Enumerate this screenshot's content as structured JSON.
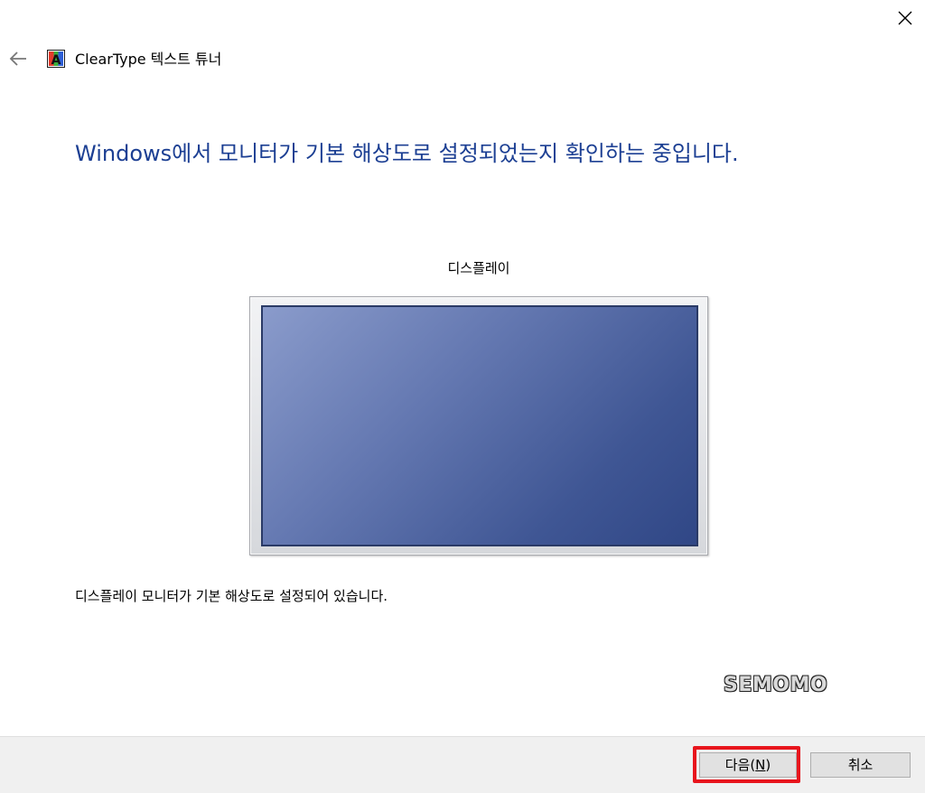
{
  "window": {
    "title": "ClearType 텍스트 튜너",
    "close_icon": "close-icon",
    "back_icon": "arrow-left-icon",
    "app_icon": "cleartype-icon"
  },
  "main": {
    "headline": "Windows에서 모니터가 기본 해상도로 설정되었는지 확인하는 중입니다.",
    "display_label": "디스플레이",
    "status_text": "디스플레이 모니터가 기본 해상도로 설정되어 있습니다."
  },
  "watermark": "SEMOMO",
  "footer": {
    "next_label_main": "다음(",
    "next_mnemonic": "N",
    "next_label_end": ")",
    "cancel_label": "취소"
  },
  "colors": {
    "headline": "#1c3f93",
    "highlight": "#e8151d",
    "footer_bg": "#f0f0f0"
  }
}
